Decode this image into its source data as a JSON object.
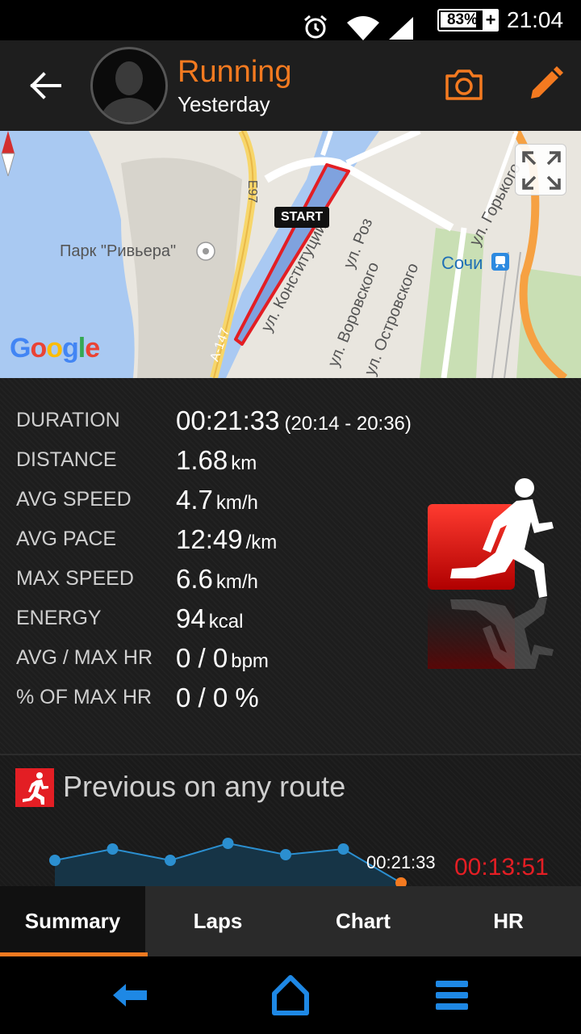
{
  "status_bar": {
    "battery_percent": "83%",
    "battery_level": 0.83,
    "charging_symbol": "+",
    "time": "21:04",
    "icons": [
      "alarm-icon",
      "wifi-icon",
      "signal-icon",
      "battery-icon"
    ]
  },
  "header": {
    "title": "Running",
    "subtitle": "Yesterday",
    "icons": [
      "back-arrow-icon",
      "avatar",
      "camera-icon",
      "pencil-icon"
    ],
    "accent_color": "#f47a20"
  },
  "map": {
    "labels": {
      "park": "Парк \"Ривьера\"",
      "road_e97": "E97",
      "road_a147": "A-147",
      "street_konst": "ул. Конституции",
      "street_roz": "ул. Роз",
      "street_vorovskogo": "ул. Воровского",
      "street_ostrovskogo": "ул. Островского",
      "street_gorkogo": "ул. Горького",
      "station": "Сочи"
    },
    "start_label": "START",
    "google_logo": "Google",
    "icons": [
      "compass-icon",
      "fullscreen-icon",
      "train-station-icon",
      "park-icon"
    ]
  },
  "stats": [
    {
      "label": "DURATION",
      "value": "00:21:33",
      "unit": "",
      "extra": "(20:14 - 20:36)"
    },
    {
      "label": "DISTANCE",
      "value": "1.68",
      "unit": "km",
      "extra": ""
    },
    {
      "label": "AVG SPEED",
      "value": "4.7",
      "unit": "km/h",
      "extra": ""
    },
    {
      "label": "AVG PACE",
      "value": "12:49",
      "unit": "/km",
      "extra": ""
    },
    {
      "label": "MAX SPEED",
      "value": "6.6",
      "unit": "km/h",
      "extra": ""
    },
    {
      "label": "ENERGY",
      "value": "94",
      "unit": "kcal",
      "extra": ""
    },
    {
      "label": "AVG / MAX HR",
      "value": "0 / 0",
      "unit": "bpm",
      "extra": ""
    },
    {
      "label": "% OF MAX HR",
      "value": "0 / 0 %",
      "unit": "",
      "extra": ""
    }
  ],
  "previous": {
    "title": "Previous on any route",
    "current_time": "00:21:33",
    "best_time": "00:13:51",
    "best_color": "#e31e24"
  },
  "chart_data": {
    "type": "line",
    "x": [
      1,
      2,
      3,
      4,
      5,
      6,
      7
    ],
    "series": [
      {
        "values": [
          4,
          6,
          4,
          7,
          5,
          6,
          0
        ]
      }
    ],
    "highlight_last_point": true
  },
  "tabs": [
    {
      "label": "Summary",
      "active": true
    },
    {
      "label": "Laps",
      "active": false
    },
    {
      "label": "Chart",
      "active": false
    },
    {
      "label": "HR",
      "active": false
    }
  ],
  "navbar": {
    "icons": [
      "nav-back-icon",
      "nav-home-icon",
      "nav-menu-icon"
    ],
    "color": "#1e88e5"
  }
}
